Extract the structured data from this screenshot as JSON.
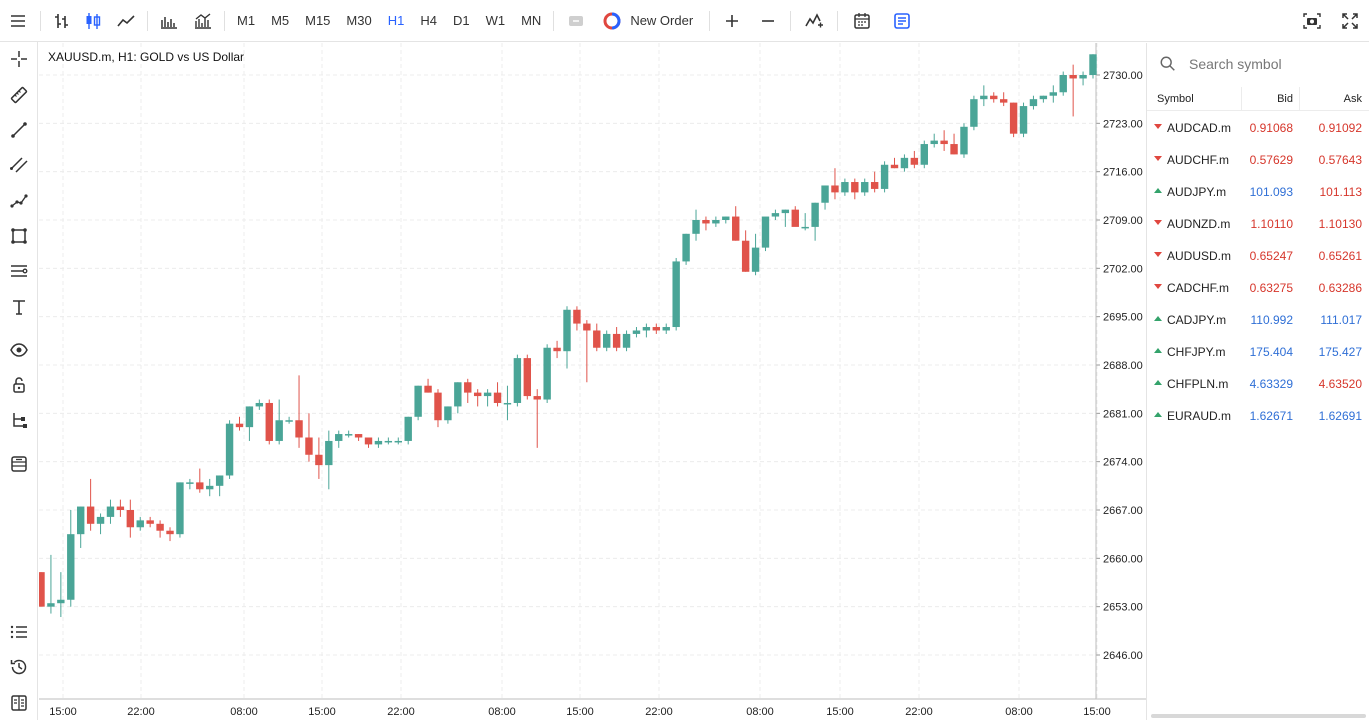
{
  "toolbar": {
    "timeframes": [
      "M1",
      "M5",
      "M15",
      "M30",
      "H1",
      "H4",
      "D1",
      "W1",
      "MN"
    ],
    "active_timeframe": "H1",
    "new_order_label": "New Order",
    "accent_color": "#2962ff"
  },
  "chart": {
    "title": "XAUUSD.m, H1: GOLD vs US Dollar",
    "up_color": "#4aa597",
    "down_color": "#e0534a"
  },
  "chart_data": {
    "type": "candlestick",
    "title": "XAUUSD.m, H1: GOLD vs US Dollar",
    "ylim": [
      2641.0,
      2733.0
    ],
    "y_ticks": [
      "2730.00",
      "2723.00",
      "2716.00",
      "2709.00",
      "2702.00",
      "2695.00",
      "2688.00",
      "2681.00",
      "2674.00",
      "2667.00",
      "2660.00",
      "2653.00",
      "2646.00"
    ],
    "x_ticks": [
      "15:00",
      "22:00",
      "08:00",
      "15:00",
      "22:00",
      "08:00",
      "15:00",
      "22:00",
      "08:00",
      "15:00",
      "22:00",
      "08:00",
      "15:00"
    ],
    "grid": true,
    "candles": [
      [
        2658.0,
        2658.0,
        2653.0,
        2653.0
      ],
      [
        2653.0,
        2660.5,
        2652.0,
        2653.5
      ],
      [
        2653.5,
        2658.0,
        2651.5,
        2654.0
      ],
      [
        2654.0,
        2667.0,
        2653.0,
        2663.5
      ],
      [
        2663.5,
        2667.5,
        2661.5,
        2667.5
      ],
      [
        2667.5,
        2671.5,
        2664.0,
        2665.0
      ],
      [
        2665.0,
        2666.5,
        2663.5,
        2666.0
      ],
      [
        2666.0,
        2668.5,
        2665.0,
        2667.5
      ],
      [
        2667.5,
        2668.5,
        2666.0,
        2667.0
      ],
      [
        2667.0,
        2668.5,
        2663.0,
        2664.5
      ],
      [
        2664.5,
        2666.0,
        2664.0,
        2665.5
      ],
      [
        2665.5,
        2666.0,
        2664.5,
        2665.0
      ],
      [
        2665.0,
        2665.5,
        2663.0,
        2664.0
      ],
      [
        2664.0,
        2664.5,
        2662.5,
        2663.5
      ],
      [
        2663.5,
        2671.0,
        2663.0,
        2671.0
      ],
      [
        2671.0,
        2671.5,
        2670.0,
        2671.0
      ],
      [
        2671.0,
        2673.0,
        2669.5,
        2670.0
      ],
      [
        2670.0,
        2671.5,
        2669.0,
        2670.5
      ],
      [
        2670.5,
        2672.0,
        2669.0,
        2672.0
      ],
      [
        2672.0,
        2680.0,
        2671.5,
        2679.5
      ],
      [
        2679.5,
        2680.5,
        2678.5,
        2679.0
      ],
      [
        2679.0,
        2682.0,
        2677.0,
        2682.0
      ],
      [
        2682.0,
        2683.0,
        2681.5,
        2682.5
      ],
      [
        2682.5,
        2683.0,
        2676.5,
        2677.0
      ],
      [
        2677.0,
        2683.0,
        2676.5,
        2680.0
      ],
      [
        2680.0,
        2680.5,
        2679.5,
        2680.0
      ],
      [
        2680.0,
        2686.5,
        2676.0,
        2677.5
      ],
      [
        2677.5,
        2681.0,
        2674.0,
        2675.0
      ],
      [
        2675.0,
        2677.5,
        2671.5,
        2673.5
      ],
      [
        2673.5,
        2678.5,
        2670.0,
        2677.0
      ],
      [
        2677.0,
        2678.5,
        2676.0,
        2678.0
      ],
      [
        2678.0,
        2678.5,
        2677.5,
        2678.0
      ],
      [
        2678.0,
        2678.0,
        2677.0,
        2677.5
      ],
      [
        2677.5,
        2677.5,
        2676.0,
        2676.5
      ],
      [
        2676.5,
        2677.5,
        2676.0,
        2677.0
      ],
      [
        2677.0,
        2677.5,
        2676.5,
        2677.0
      ],
      [
        2677.0,
        2677.5,
        2676.5,
        2677.0
      ],
      [
        2677.0,
        2680.5,
        2676.5,
        2680.5
      ],
      [
        2680.5,
        2685.0,
        2680.0,
        2685.0
      ],
      [
        2685.0,
        2686.0,
        2684.0,
        2684.0
      ],
      [
        2684.0,
        2684.5,
        2679.0,
        2680.0
      ],
      [
        2680.0,
        2682.0,
        2679.5,
        2682.0
      ],
      [
        2682.0,
        2685.5,
        2681.0,
        2685.5
      ],
      [
        2685.5,
        2686.0,
        2682.5,
        2684.0
      ],
      [
        2684.0,
        2684.5,
        2682.0,
        2683.5
      ],
      [
        2683.5,
        2684.5,
        2682.0,
        2684.0
      ],
      [
        2684.0,
        2685.5,
        2682.0,
        2682.5
      ],
      [
        2682.5,
        2685.0,
        2680.0,
        2682.5
      ],
      [
        2682.5,
        2689.5,
        2682.0,
        2689.0
      ],
      [
        2689.0,
        2689.5,
        2683.0,
        2683.5
      ],
      [
        2683.5,
        2684.5,
        2676.0,
        2683.0
      ],
      [
        2683.0,
        2691.0,
        2682.5,
        2690.5
      ],
      [
        2690.5,
        2691.5,
        2689.0,
        2690.0
      ],
      [
        2690.0,
        2696.5,
        2687.5,
        2696.0
      ],
      [
        2696.0,
        2696.5,
        2693.0,
        2694.0
      ],
      [
        2694.0,
        2694.5,
        2685.5,
        2693.0
      ],
      [
        2693.0,
        2694.0,
        2690.0,
        2690.5
      ],
      [
        2690.5,
        2693.0,
        2690.0,
        2692.5
      ],
      [
        2692.5,
        2693.5,
        2690.0,
        2690.5
      ],
      [
        2690.5,
        2693.0,
        2690.0,
        2692.5
      ],
      [
        2692.5,
        2693.5,
        2692.0,
        2693.0
      ],
      [
        2693.0,
        2694.0,
        2692.0,
        2693.5
      ],
      [
        2693.5,
        2694.0,
        2692.5,
        2693.0
      ],
      [
        2693.0,
        2694.0,
        2692.5,
        2693.5
      ],
      [
        2693.5,
        2703.5,
        2693.0,
        2703.0
      ],
      [
        2703.0,
        2707.0,
        2702.5,
        2707.0
      ],
      [
        2707.0,
        2710.5,
        2706.0,
        2709.0
      ],
      [
        2709.0,
        2709.5,
        2707.5,
        2708.5
      ],
      [
        2708.5,
        2709.5,
        2708.0,
        2709.0
      ],
      [
        2709.0,
        2709.5,
        2708.5,
        2709.5
      ],
      [
        2709.5,
        2711.0,
        2706.0,
        2706.0
      ],
      [
        2706.0,
        2707.5,
        2701.5,
        2701.5
      ],
      [
        2701.5,
        2707.0,
        2701.0,
        2705.0
      ],
      [
        2705.0,
        2708.0,
        2704.5,
        2709.5
      ],
      [
        2709.5,
        2710.5,
        2709.0,
        2710.0
      ],
      [
        2710.0,
        2710.5,
        2708.0,
        2710.5
      ],
      [
        2710.5,
        2711.0,
        2709.0,
        2708.0
      ],
      [
        2708.0,
        2710.0,
        2707.5,
        2708.0
      ],
      [
        2708.0,
        2711.5,
        2706.0,
        2711.5
      ],
      [
        2711.5,
        2714.0,
        2710.5,
        2714.0
      ],
      [
        2714.0,
        2716.5,
        2712.0,
        2713.0
      ],
      [
        2713.0,
        2715.0,
        2712.5,
        2714.5
      ],
      [
        2714.5,
        2715.0,
        2712.0,
        2713.0
      ],
      [
        2713.0,
        2715.0,
        2712.5,
        2714.5
      ],
      [
        2714.5,
        2716.0,
        2713.0,
        2713.5
      ],
      [
        2713.5,
        2717.5,
        2713.0,
        2717.0
      ],
      [
        2717.0,
        2718.0,
        2716.5,
        2716.5
      ],
      [
        2716.5,
        2718.5,
        2716.0,
        2718.0
      ],
      [
        2718.0,
        2719.0,
        2716.5,
        2717.0
      ],
      [
        2717.0,
        2720.5,
        2716.5,
        2720.0
      ],
      [
        2720.0,
        2721.5,
        2719.5,
        2720.5
      ],
      [
        2720.5,
        2722.0,
        2719.0,
        2720.0
      ],
      [
        2720.0,
        2721.5,
        2718.5,
        2718.5
      ],
      [
        2718.5,
        2723.0,
        2718.0,
        2722.5
      ],
      [
        2722.5,
        2727.0,
        2722.0,
        2726.5
      ],
      [
        2726.5,
        2728.5,
        2725.5,
        2727.0
      ],
      [
        2727.0,
        2727.5,
        2726.0,
        2726.5
      ],
      [
        2726.5,
        2727.5,
        2725.5,
        2726.0
      ],
      [
        2726.0,
        2726.0,
        2721.0,
        2721.5
      ],
      [
        2721.5,
        2726.0,
        2721.0,
        2725.5
      ],
      [
        2725.5,
        2727.0,
        2725.0,
        2726.5
      ],
      [
        2726.5,
        2727.0,
        2726.0,
        2727.0
      ],
      [
        2727.0,
        2728.5,
        2726.0,
        2727.5
      ],
      [
        2727.5,
        2730.5,
        2727.0,
        2730.0
      ],
      [
        2730.0,
        2731.5,
        2724.0,
        2729.5
      ],
      [
        2729.5,
        2730.5,
        2728.5,
        2730.0
      ],
      [
        2730.0,
        2733.0,
        2729.5,
        2733.0
      ]
    ]
  },
  "market_watch": {
    "search_placeholder": "Search symbol",
    "headers": {
      "symbol": "Symbol",
      "bid": "Bid",
      "ask": "Ask"
    },
    "rows": [
      {
        "symbol": "AUDCAD.m",
        "bid": "0.91068",
        "ask": "0.91092",
        "dir": "down",
        "bid_color": "red",
        "ask_color": "red"
      },
      {
        "symbol": "AUDCHF.m",
        "bid": "0.57629",
        "ask": "0.57643",
        "dir": "down",
        "bid_color": "red",
        "ask_color": "red"
      },
      {
        "symbol": "AUDJPY.m",
        "bid": "101.093",
        "ask": "101.113",
        "dir": "up",
        "bid_color": "blue",
        "ask_color": "red"
      },
      {
        "symbol": "AUDNZD.m",
        "bid": "1.10110",
        "ask": "1.10130",
        "dir": "down",
        "bid_color": "red",
        "ask_color": "red"
      },
      {
        "symbol": "AUDUSD.m",
        "bid": "0.65247",
        "ask": "0.65261",
        "dir": "down",
        "bid_color": "red",
        "ask_color": "red"
      },
      {
        "symbol": "CADCHF.m",
        "bid": "0.63275",
        "ask": "0.63286",
        "dir": "down",
        "bid_color": "red",
        "ask_color": "red"
      },
      {
        "symbol": "CADJPY.m",
        "bid": "110.992",
        "ask": "111.017",
        "dir": "up",
        "bid_color": "blue",
        "ask_color": "blue"
      },
      {
        "symbol": "CHFJPY.m",
        "bid": "175.404",
        "ask": "175.427",
        "dir": "up",
        "bid_color": "blue",
        "ask_color": "blue"
      },
      {
        "symbol": "CHFPLN.m",
        "bid": "4.63329",
        "ask": "4.63520",
        "dir": "up",
        "bid_color": "blue",
        "ask_color": "red"
      },
      {
        "symbol": "EURAUD.m",
        "bid": "1.62671",
        "ask": "1.62691",
        "dir": "up",
        "bid_color": "blue",
        "ask_color": "blue"
      }
    ]
  }
}
